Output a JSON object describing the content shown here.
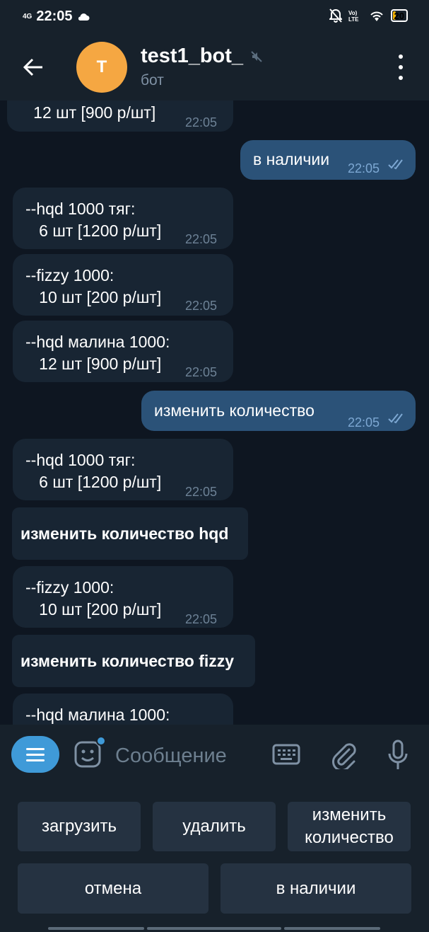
{
  "status_bar": {
    "time": "22:05",
    "network": "4G",
    "battery": "20",
    "battery_fraction": 0.2
  },
  "header": {
    "title": "test1_bot_",
    "subtitle": "бот",
    "avatar_letter": "T",
    "avatar_color": "#f5a742"
  },
  "messages": [
    {
      "text": "   12 шт [900 р/шт]",
      "time": "22:05"
    },
    {
      "text": "в наличии",
      "time": "22:05"
    },
    {
      "text": "--hqd 1000 тяг:\n   6 шт [1200 р/шт]",
      "time": "22:05"
    },
    {
      "text": "--fizzy 1000:\n   10 шт [200 р/шт]",
      "time": "22:05"
    },
    {
      "text": "--hqd малина 1000:\n   12 шт [900 р/шт]",
      "time": "22:05"
    },
    {
      "text": "изменить количество",
      "time": "22:05"
    },
    {
      "text": "--hqd 1000 тяг:\n   6 шт [1200 р/шт]",
      "time": "22:05"
    },
    {
      "text": "--fizzy 1000:\n   10 шт [200 р/шт]",
      "time": "22:05"
    },
    {
      "text": "--hqd малина 1000:",
      "time": ""
    }
  ],
  "inline_buttons": [
    "изменить количество hqd",
    "изменить количество fizzy"
  ],
  "input": {
    "placeholder": "Сообщение"
  },
  "keyboard": {
    "row1": [
      "загрузить",
      "удалить",
      "изменить\nколичество"
    ],
    "row2": [
      "отмена",
      "в наличии"
    ]
  },
  "colors": {
    "background": "#0e1621",
    "bar": "#17212b",
    "incoming": "#182533",
    "outgoing": "#2b5278",
    "accent": "#3f9ad8"
  }
}
